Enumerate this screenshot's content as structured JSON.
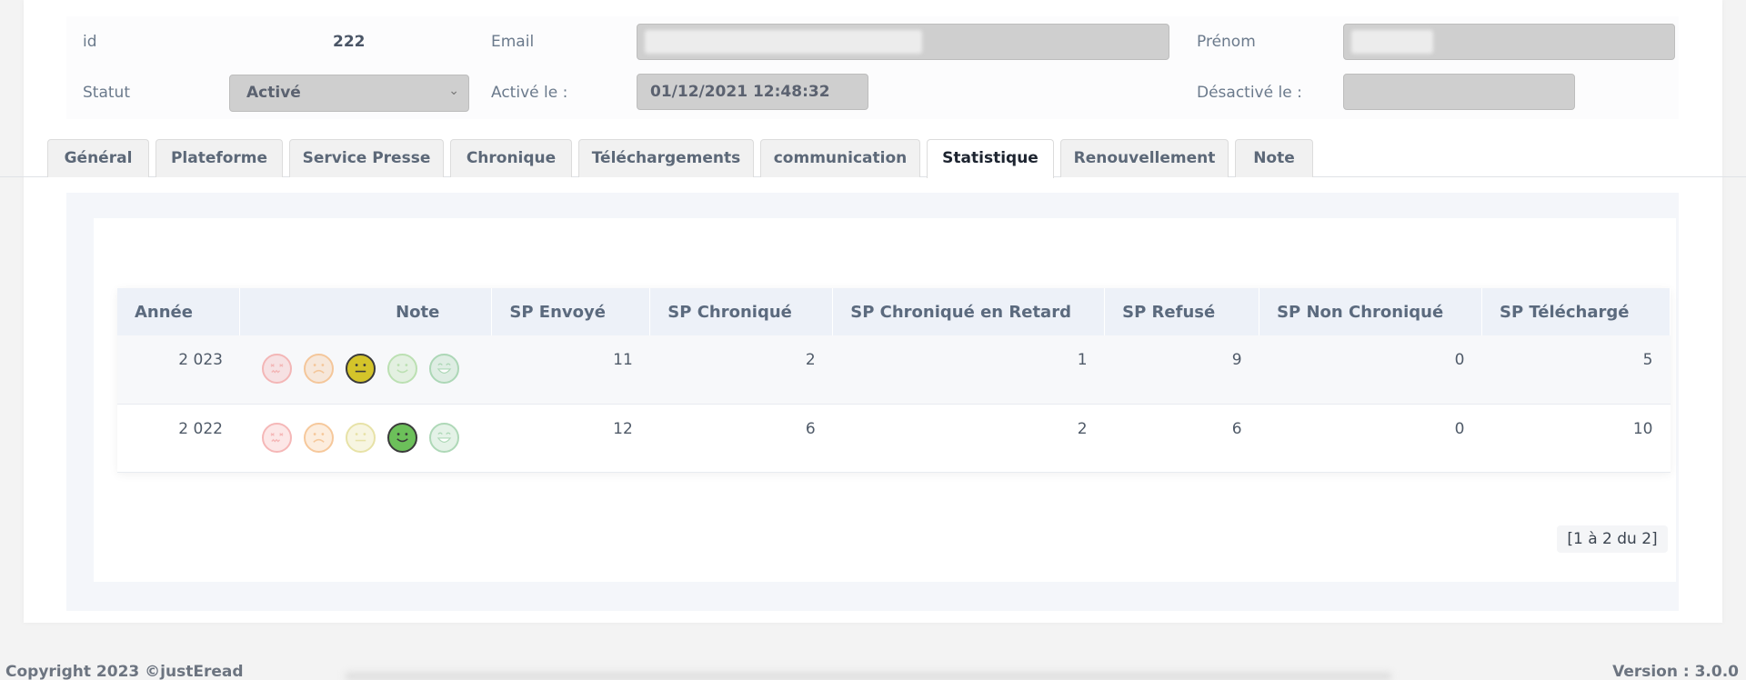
{
  "info": {
    "id_label": "id",
    "id_value": "222",
    "email_label": "Email",
    "prenom_label": "Prénom",
    "statut_label": "Statut",
    "statut_value": "Activé",
    "active_le_label": "Activé le :",
    "active_le_value": "01/12/2021 12:48:32",
    "desactive_le_label": "Désactivé le :"
  },
  "tabs": [
    {
      "label": "Général"
    },
    {
      "label": "Plateforme"
    },
    {
      "label": "Service Presse"
    },
    {
      "label": "Chronique"
    },
    {
      "label": "Téléchargements"
    },
    {
      "label": "communication"
    },
    {
      "label": "Statistique",
      "active": true
    },
    {
      "label": "Renouvellement"
    },
    {
      "label": "Note"
    }
  ],
  "table": {
    "headers": [
      "Année",
      "Note",
      "SP Envoyé",
      "SP Chroniqué",
      "SP Chroniqué en Retard",
      "SP Refusé",
      "SP Non Chroniqué",
      "SP Téléchargé"
    ],
    "rows": [
      {
        "annee": "2 023",
        "note_selected": 2,
        "sp_envoye": "11",
        "sp_chronique": "2",
        "sp_retard": "1",
        "sp_refuse": "9",
        "sp_non_chronique": "0",
        "sp_telecharge": "5"
      },
      {
        "annee": "2 022",
        "note_selected": 3,
        "sp_envoye": "12",
        "sp_chronique": "6",
        "sp_retard": "2",
        "sp_refuse": "6",
        "sp_non_chronique": "0",
        "sp_telecharge": "10"
      }
    ]
  },
  "faces": [
    {
      "name": "angry-face-icon",
      "color": "#f2a0a0",
      "active_color": "#e86060"
    },
    {
      "name": "sad-face-icon",
      "color": "#f3b67a",
      "active_color": "#f39a35"
    },
    {
      "name": "neutral-face-icon",
      "color": "#e0d98a",
      "active_color": "#d4c42a"
    },
    {
      "name": "smile-face-icon",
      "color": "#a8d89a",
      "active_color": "#6cc05a"
    },
    {
      "name": "grin-face-icon",
      "color": "#94cca0",
      "active_color": "#4fae66"
    }
  ],
  "pager": {
    "text": "[1 à 2 du 2]"
  },
  "footer": {
    "copyright": "Copyright 2023 ©justEread",
    "version": "Version : 3.0.0"
  }
}
